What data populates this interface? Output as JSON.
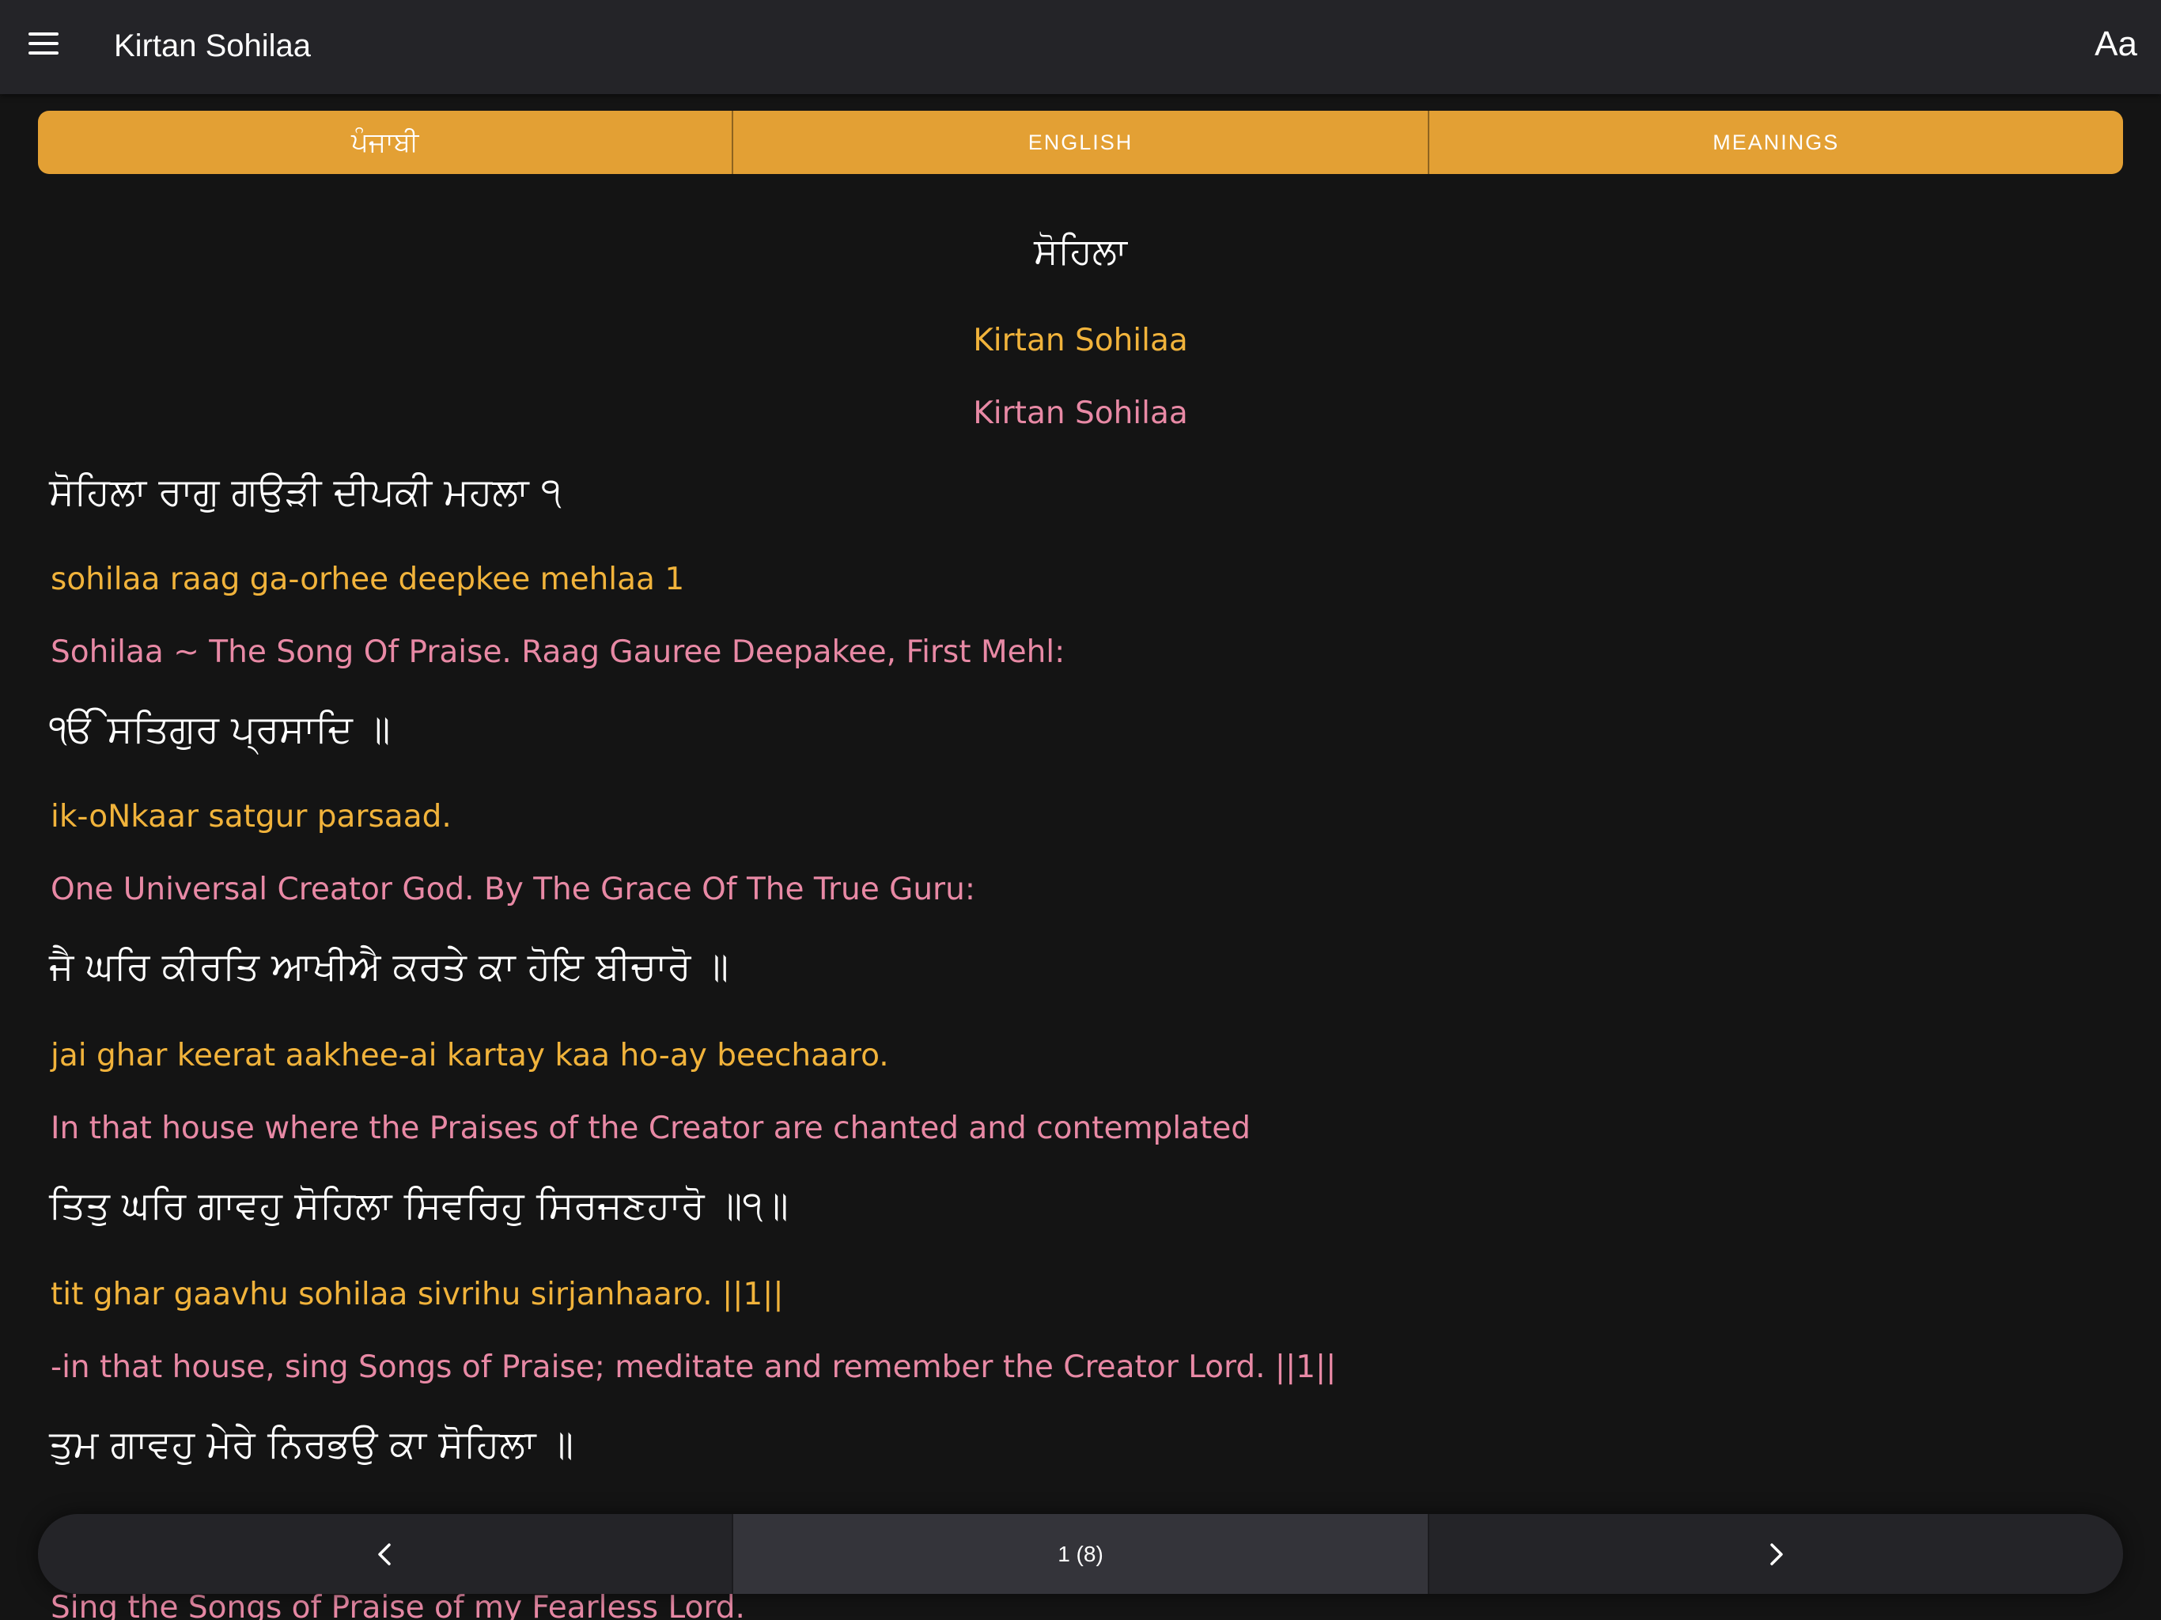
{
  "header": {
    "title": "Kirtan Sohilaa",
    "menu_icon": "hamburger-menu-icon",
    "font_button_label": "Aa"
  },
  "tabs": [
    {
      "label": "ਪੰਜਾਬੀ"
    },
    {
      "label": "ENGLISH"
    },
    {
      "label": "MEANINGS"
    }
  ],
  "content": {
    "heading": {
      "gurmukhi": "ਸੋਹਿਲਾ",
      "transliteration": "Kirtan Sohilaa",
      "translation": "Kirtan Sohilaa"
    },
    "verses": [
      {
        "gurmukhi": "ਸੋਹਿਲਾ ਰਾਗੁ ਗਉੜੀ ਦੀਪਕੀ ਮਹਲਾ ੧",
        "transliteration": "sohilaa raag ga-orhee deepkee mehlaa 1",
        "translation": "Sohilaa ~ The Song Of Praise. Raag Gauree Deepakee, First Mehl:"
      },
      {
        "gurmukhi": "ੴ ਸਤਿਗੁਰ ਪ੍ਰਸਾਦਿ ॥",
        "transliteration": "ik-oNkaar satgur parsaad.",
        "translation": "One Universal Creator God. By The Grace Of The True Guru:"
      },
      {
        "gurmukhi": "ਜੈ ਘਰਿ ਕੀਰਤਿ ਆਖੀਐ ਕਰਤੇ ਕਾ ਹੋਇ ਬੀਚਾਰੋ ॥",
        "transliteration": "jai ghar keerat aakhee-ai kartay kaa ho-ay beechaaro.",
        "translation": "In that house where the Praises of the Creator are chanted and contemplated"
      },
      {
        "gurmukhi": "ਤਿਤੁ ਘਰਿ ਗਾਵਹੁ ਸੋਹਿਲਾ ਸਿਵਰਿਹੁ ਸਿਰਜਣਹਾਰੋ ॥੧॥",
        "transliteration": "tit ghar gaavhu sohilaa sivrihu sirjanhaaro. ||1||",
        "translation": "-in that house, sing Songs of Praise; meditate and remember the Creator Lord. ||1||"
      },
      {
        "gurmukhi": "ਤੁਮ ਗਾਵਹੁ ਮੇਰੇ ਨਿਰਭਉ ਕਾ ਸੋਹਿਲਾ ॥",
        "translation": "Sing the Songs of Praise of my Fearless Lord."
      }
    ]
  },
  "pager": {
    "prev_icon": "chevron-left-icon",
    "next_icon": "chevron-right-icon",
    "page_label": "1 (8)"
  },
  "colors": {
    "background": "#141414",
    "header": "#242428",
    "accent": "#e3a034",
    "transliteration": "#f1b33b",
    "translation": "#e889a5"
  }
}
